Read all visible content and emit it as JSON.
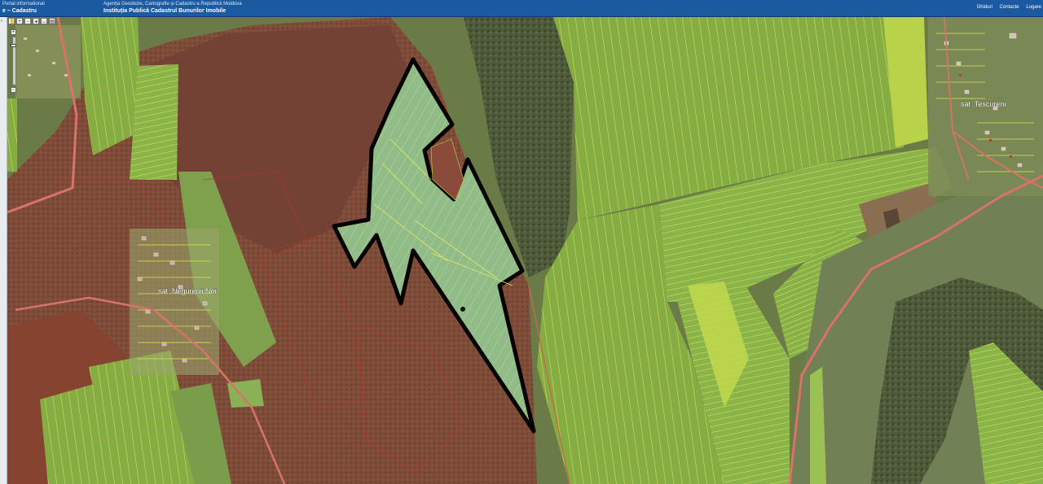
{
  "header": {
    "portal_small": "Portal informational",
    "portal_title": "e – Cadastru",
    "agency": "Agenția Geodezie, Cartografie și Cadastru a Republicii Moldova",
    "institution": "Instituția Publică Cadastrul Bunurilor Imobile",
    "links": [
      "Ghiduri",
      "Contacte",
      "Logare"
    ]
  },
  "map": {
    "places": [
      "sat. Negurenii Noi",
      "sat. Tescureni"
    ],
    "colors": {
      "forest_parcel": "#8a4b3a",
      "field_parcel": "#8fb64e",
      "parcel_edge": "#d9e84a",
      "highlight_fill": "#b9d8a6",
      "highlight_edge": "#000000",
      "road": "#d9736a"
    },
    "toolbar_icons": [
      "pan-icon",
      "zoom-in-box-icon",
      "zoom-out-box-icon",
      "back-icon",
      "measure-icon",
      "print-icon"
    ],
    "zoom_level_fraction": 0.85
  }
}
